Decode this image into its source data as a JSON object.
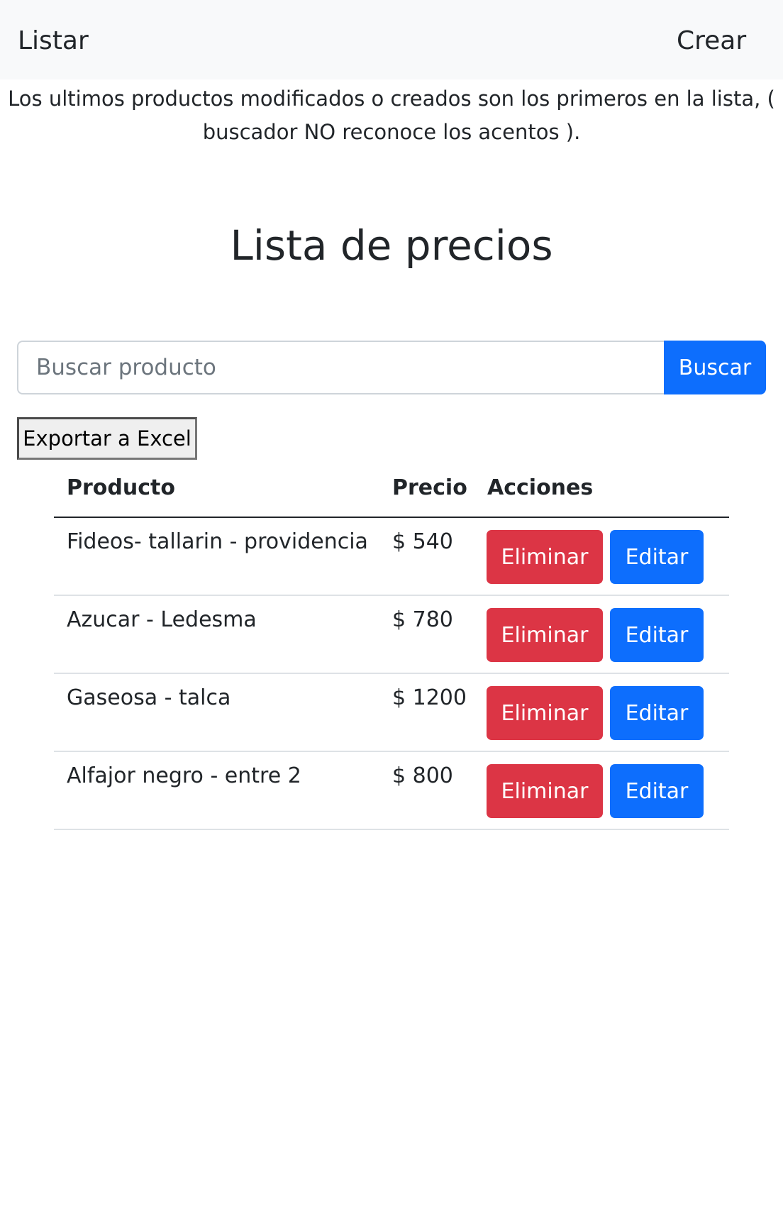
{
  "navbar": {
    "listar": "Listar",
    "crear": "Crear"
  },
  "notice": {
    "line1": "Los ultimos productos modificados o creados son los primeros en la lista, (",
    "line2": "buscador NO reconoce los acentos )."
  },
  "page_title": "Lista de precios",
  "search": {
    "placeholder": "Buscar producto",
    "value": "",
    "button_label": "Buscar"
  },
  "export_label": "Exportar a Excel",
  "table": {
    "headers": {
      "producto": "Producto",
      "precio": "Precio",
      "acciones": "Acciones"
    },
    "rows": [
      {
        "producto": "Fideos- tallarin - providencia",
        "precio": "$ 540",
        "eliminar": "Eliminar",
        "editar": "Editar"
      },
      {
        "producto": "Azucar - Ledesma",
        "precio": "$ 780",
        "eliminar": "Eliminar",
        "editar": "Editar"
      },
      {
        "producto": "Gaseosa - talca",
        "precio": "$ 1200",
        "eliminar": "Eliminar",
        "editar": "Editar"
      },
      {
        "producto": "Alfajor negro - entre 2",
        "precio": "$ 800",
        "eliminar": "Eliminar",
        "editar": "Editar"
      }
    ]
  },
  "colors": {
    "navbar_bg": "#f8f9fa",
    "primary": "#0d6efd",
    "danger": "#dc3545",
    "text": "#212529"
  }
}
